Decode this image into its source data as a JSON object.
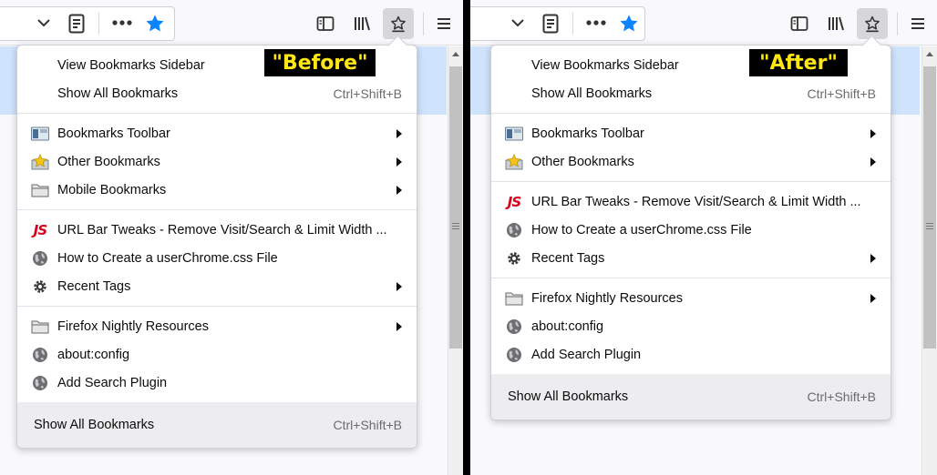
{
  "before": {
    "tag_label": "\"Before\"",
    "menu": {
      "view_sidebar": "View Bookmarks Sidebar",
      "show_all": "Show All Bookmarks",
      "show_all_shortcut": "Ctrl+Shift+B",
      "bookmarks_toolbar": "Bookmarks Toolbar",
      "other_bookmarks": "Other Bookmarks",
      "mobile_bookmarks": "Mobile Bookmarks",
      "url_bar_tweaks": "URL Bar Tweaks - Remove Visit/Search & Limit Width ...",
      "userchrome": "How to Create a userChrome.css File",
      "recent_tags": "Recent Tags",
      "nightly_resources": "Firefox Nightly Resources",
      "about_config": "about:config",
      "add_search_plugin": "Add Search Plugin"
    },
    "footer": {
      "label": "Show All Bookmarks",
      "shortcut": "Ctrl+Shift+B"
    }
  },
  "after": {
    "tag_label": "\"After\"",
    "menu": {
      "view_sidebar": "View Bookmarks Sidebar",
      "show_all": "Show All Bookmarks",
      "show_all_shortcut": "Ctrl+Shift+B",
      "bookmarks_toolbar": "Bookmarks Toolbar",
      "other_bookmarks": "Other Bookmarks",
      "url_bar_tweaks": "URL Bar Tweaks - Remove Visit/Search & Limit Width ...",
      "userchrome": "How to Create a userChrome.css File",
      "recent_tags": "Recent Tags",
      "nightly_resources": "Firefox Nightly Resources",
      "about_config": "about:config",
      "add_search_plugin": "Add Search Plugin"
    },
    "footer": {
      "label": "Show All Bookmarks",
      "shortcut": "Ctrl+Shift+B"
    }
  },
  "icons": {
    "js_icon_text": "JS",
    "colors": {
      "star_blue": "#0a84ff",
      "highlight_blue": "#cfe3fd",
      "tag_yellow": "#ffe713",
      "js_red": "#d7001a"
    }
  }
}
